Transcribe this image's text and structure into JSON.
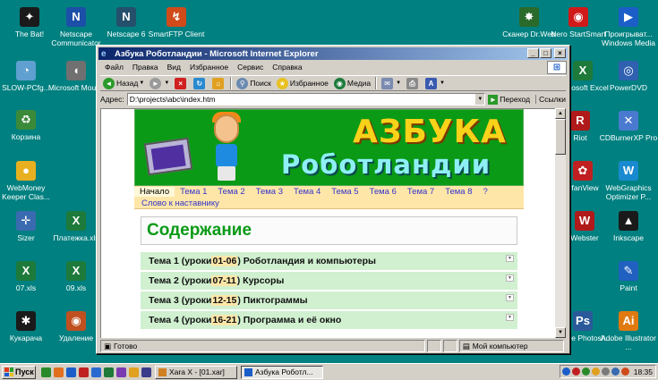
{
  "desktop": {
    "icons_left": [
      {
        "label": "The Bat!",
        "icon": "bat-icon",
        "color": "#1a1a1a"
      },
      {
        "label": "Netscape Communicator",
        "icon": "netscape-icon",
        "color": "#1c4fa8"
      },
      {
        "label": "Netscape 6",
        "icon": "netscape6-icon",
        "color": "#24506c"
      },
      {
        "label": "SmartFTP Client",
        "icon": "smartftp-icon",
        "color": "#d04a1a"
      },
      {
        "label": "SLOW-PCfg...",
        "icon": "speedometer-icon",
        "color": "#5fa0d0"
      },
      {
        "label": "Microsoft Mouse",
        "icon": "mouse-icon",
        "color": "#707070"
      },
      {
        "label": "Корзина",
        "icon": "recycle-bin-icon",
        "color": "#3a8a3a"
      },
      {
        "label": "WebMoney Keeper Clas...",
        "icon": "webmoney-icon",
        "color": "#e8b020"
      },
      {
        "label": "Sizer",
        "icon": "sizer-icon",
        "color": "#3a6ab0"
      },
      {
        "label": "Платежка.xls",
        "icon": "excel-file-icon",
        "color": "#1d7a3a"
      },
      {
        "label": "07.xls",
        "icon": "excel-file-icon",
        "color": "#1d7a3a"
      },
      {
        "label": "09.xls",
        "icon": "excel-file-icon",
        "color": "#1d7a3a"
      },
      {
        "label": "Кукарача",
        "icon": "cockroach-icon",
        "color": "#1a1a1a"
      },
      {
        "label": "Удаление",
        "icon": "uninstall-icon",
        "color": "#c05020"
      }
    ],
    "icons_right": [
      {
        "label": "Сканер Dr.Web",
        "icon": "drweb-icon",
        "color": "#2a6a2a"
      },
      {
        "label": "Nero StartSmart",
        "icon": "nero-icon",
        "color": "#d01a1a"
      },
      {
        "label": "Проигрыват... Windows Media",
        "icon": "media-player-icon",
        "color": "#1c5ec8"
      },
      {
        "label": "Microsoft Excel",
        "icon": "excel-icon",
        "color": "#1d7a3a"
      },
      {
        "label": "PowerDVD",
        "icon": "powerdvd-icon",
        "color": "#3060b0"
      },
      {
        "label": "Riot",
        "icon": "riot-icon",
        "color": "#b01a1a"
      },
      {
        "label": "CDBurnerXP Pro",
        "icon": "cdburner-icon",
        "color": "#4a7ad0"
      },
      {
        "label": "IrfanView",
        "icon": "irfanview-icon",
        "color": "#c02020"
      },
      {
        "label": "WebGraphics Optimizer P...",
        "icon": "webgraphics-icon",
        "color": "#1a8ad0"
      },
      {
        "label": "Webster",
        "icon": "webster-icon",
        "color": "#b01a1a"
      },
      {
        "label": "Inkscape",
        "icon": "inkscape-icon",
        "color": "#1a1a1a"
      },
      {
        "label": "Paint",
        "icon": "paint-icon",
        "color": "#2060c0"
      },
      {
        "label": "Adobe Photosh...",
        "icon": "photoshop-icon",
        "color": "#2a5a9a"
      },
      {
        "label": "Adobe Illustrator ...",
        "icon": "illustrator-icon",
        "color": "#e07a10"
      }
    ]
  },
  "window": {
    "title": "Азбука Роботландии - Microsoft Internet Explorer",
    "menu": [
      "Файл",
      "Правка",
      "Вид",
      "Избранное",
      "Сервис",
      "Справка"
    ],
    "toolbar": {
      "back": "Назад",
      "search": "Поиск",
      "favorites": "Избранное",
      "media": "Медиа"
    },
    "address": {
      "label": "Адрес:",
      "value": "D:\\projects\\abc\\index.htm",
      "go": "Переход",
      "links": "Ссылки"
    },
    "status": {
      "text": "Готово",
      "zone": "Мой компьютер"
    }
  },
  "page": {
    "banner": {
      "title_line1": "АЗБУКА",
      "title_line2": "Роботландии"
    },
    "nav": [
      "Начало",
      "Тема 1",
      "Тема 2",
      "Тема 3",
      "Тема 4",
      "Тема 5",
      "Тема 6",
      "Тема 7",
      "Тема 8",
      "?"
    ],
    "nav_active": "Начало",
    "sub_nav": "Слово к наставнику",
    "section_title": "Содержание",
    "topics": [
      {
        "prefix": "Тема 1 (уроки ",
        "lessons": "01-06",
        "suffix": ") Роботландия и компьютеры"
      },
      {
        "prefix": "Тема 2 (уроки ",
        "lessons": "07-11",
        "suffix": ") Курсоры"
      },
      {
        "prefix": "Тема 3 (уроки ",
        "lessons": "12-15",
        "suffix": ") Пиктограммы"
      },
      {
        "prefix": "Тема 4 (уроки ",
        "lessons": "16-21",
        "suffix": ") Программа и её окно"
      }
    ]
  },
  "taskbar": {
    "start": "Пуск",
    "tasks": [
      {
        "label": "Xara X - [01.xar]",
        "active": false
      },
      {
        "label": "Азбука Роботл...",
        "active": true
      }
    ],
    "clock": "18:35"
  },
  "colors": {
    "desktop": "#008080",
    "banner_green": "#0a9a16",
    "nav_bg": "#fde6a8",
    "topic_bg": "#d0f0d0",
    "link": "#3333cc"
  }
}
